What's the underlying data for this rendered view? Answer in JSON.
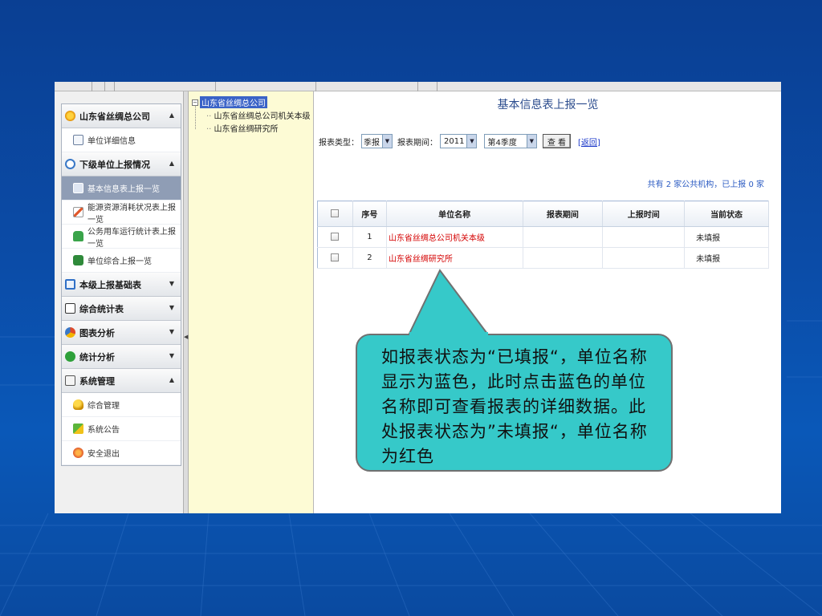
{
  "sidebar": {
    "groups": [
      {
        "label": "山东省丝绸总公司",
        "arrow": "▲",
        "items": [
          {
            "label": "单位详细信息"
          }
        ]
      },
      {
        "label": "下级单位上报情况",
        "arrow": "▲",
        "items": [
          {
            "label": "基本信息表上报一览"
          },
          {
            "label": "能源资源消耗状况表上报一览"
          },
          {
            "label": "公务用车运行统计表上报一览"
          },
          {
            "label": "单位综合上报一览"
          }
        ]
      },
      {
        "label": "本级上报基础表",
        "arrow": "▼"
      },
      {
        "label": "综合统计表",
        "arrow": "▼"
      },
      {
        "label": "图表分析",
        "arrow": "▼"
      },
      {
        "label": "统计分析",
        "arrow": "▼"
      },
      {
        "label": "系统管理",
        "arrow": "▲",
        "items": [
          {
            "label": "综合管理"
          },
          {
            "label": "系统公告"
          },
          {
            "label": "安全退出"
          }
        ]
      }
    ]
  },
  "tree": {
    "root": "山东省丝绸总公司",
    "children": [
      "山东省丝绸总公司机关本级",
      "山东省丝绸研究所"
    ]
  },
  "main": {
    "title": "基本信息表上报一览",
    "filter": {
      "type_label": "报表类型：",
      "type_value": "季报",
      "period_label": "报表期间：",
      "year_value": "2011",
      "quarter_value": "第4季度",
      "view_button": "查 看",
      "extra_link": "[返回]"
    },
    "summary": "共有 2 家公共机构，已上报 0 家",
    "table": {
      "headers": [
        "序号",
        "单位名称",
        "报表期间",
        "上报时间",
        "当前状态"
      ],
      "rows": [
        {
          "no": "1",
          "name": "山东省丝绸总公司机关本级",
          "period": "",
          "time": "",
          "status": "未填报"
        },
        {
          "no": "2",
          "name": "山东省丝绸研究所",
          "period": "",
          "time": "",
          "status": "未填报"
        }
      ]
    }
  },
  "callout": {
    "text": "如报表状态为“已填报“，单位名称显示为蓝色，此时点击蓝色的单位名称即可查看报表的详细数据。此处报表状态为”未填报“，单位名称为红色"
  }
}
